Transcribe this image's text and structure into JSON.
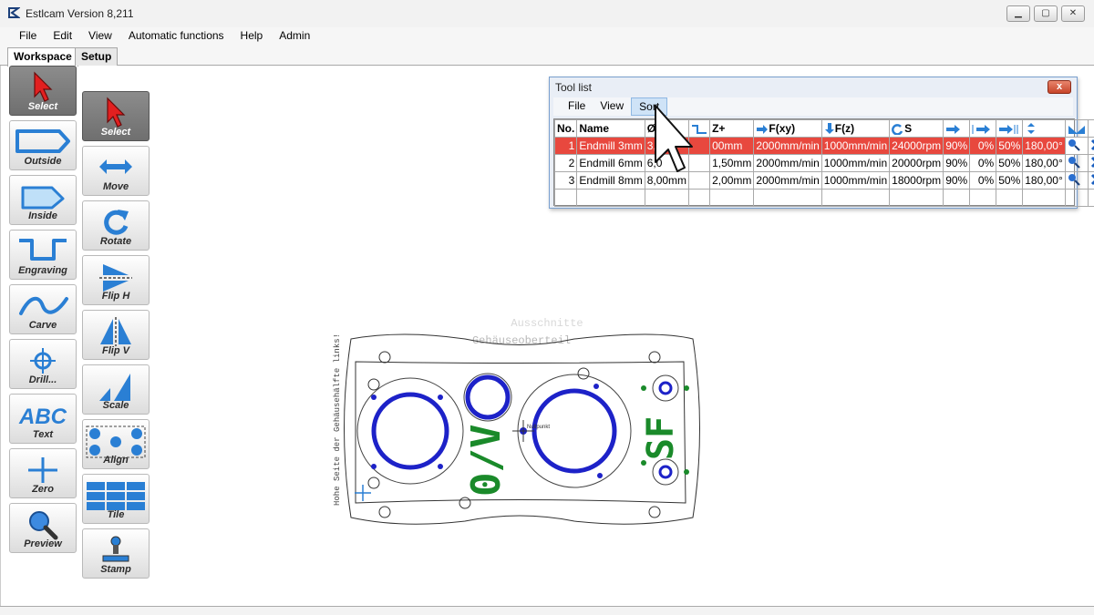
{
  "window": {
    "title": "Estlcam Version 8,211",
    "controls": [
      "minimize",
      "restore",
      "close"
    ]
  },
  "menu": [
    "File",
    "Edit",
    "View",
    "Automatic functions",
    "Help",
    "Admin"
  ],
  "tabs": [
    {
      "label": "Workspace",
      "active": true
    },
    {
      "label": "Setup",
      "active": false
    }
  ],
  "left_tools": [
    {
      "label": "Select",
      "icon": "arrow-pointer-icon",
      "selected": true
    },
    {
      "label": "Outside",
      "icon": "outside-contour-icon"
    },
    {
      "label": "Inside",
      "icon": "inside-contour-icon"
    },
    {
      "label": "Engraving",
      "icon": "engraving-icon"
    },
    {
      "label": "Carve",
      "icon": "carve-icon"
    },
    {
      "label": "Drill...",
      "icon": "drill-crosshair-icon"
    },
    {
      "label": "Text",
      "icon": "abc-text-icon"
    },
    {
      "label": "Zero",
      "icon": "zero-cross-icon"
    },
    {
      "label": "Preview",
      "icon": "magnifier-icon"
    }
  ],
  "right_tools": [
    {
      "label": "Select",
      "icon": "arrow-pointer-icon",
      "selected": true
    },
    {
      "label": "Move",
      "icon": "move-arrows-icon"
    },
    {
      "label": "Rotate",
      "icon": "rotate-icon"
    },
    {
      "label": "Flip H",
      "icon": "flip-horizontal-icon"
    },
    {
      "label": "Flip V",
      "icon": "flip-vertical-icon"
    },
    {
      "label": "Scale",
      "icon": "scale-icon"
    },
    {
      "label": "Align",
      "icon": "align-icon"
    },
    {
      "label": "Tile",
      "icon": "tile-icon"
    },
    {
      "label": "Stamp",
      "icon": "stamp-icon"
    }
  ],
  "tool_list": {
    "title": "Tool list",
    "close": "x",
    "menu": [
      "File",
      "View",
      "Sort"
    ],
    "hot_menu": "Sort",
    "headers": [
      "No.",
      "Name",
      "Ø",
      "",
      "Z+",
      "F(xy)",
      "F(z)",
      "S",
      "",
      "",
      "",
      "",
      "",
      ""
    ],
    "rows": [
      {
        "no": "1",
        "name": "Endmill 3mm",
        "dia": "3,0",
        "z": "00mm",
        "fxy": "2000mm/min",
        "fz": "1000mm/min",
        "s": "24000rpm",
        "p1": "90%",
        "p2": "0%",
        "p3": "50%",
        "angle": "180,00°",
        "selected": true
      },
      {
        "no": "2",
        "name": "Endmill 6mm",
        "dia": "6,0",
        "z": "1,50mm",
        "fxy": "2000mm/min",
        "fz": "1000mm/min",
        "s": "20000rpm",
        "p1": "90%",
        "p2": "0%",
        "p3": "50%",
        "angle": "180,00°",
        "selected": false
      },
      {
        "no": "3",
        "name": "Endmill 8mm",
        "dia": "8,00mm",
        "z": "2,00mm",
        "fxy": "2000mm/min",
        "fz": "1000mm/min",
        "s": "18000rpm",
        "p1": "90%",
        "p2": "0%",
        "p3": "50%",
        "angle": "180,00°",
        "selected": false
      }
    ]
  },
  "drawing": {
    "top_text_1": "Ausschnitte",
    "top_text_2": "Gehäuseoberteil",
    "side_text": "Hohe Seite der Gehäusehälfte links!",
    "center_label": "Nullpunkt",
    "engrave_1": "0/V",
    "engrave_2": "SF"
  },
  "colors": {
    "selected_row": "#e8483e",
    "cut_blue": "#1d22c8",
    "engrave_green": "#1a8a2a",
    "tool_blue": "#2a7fd4"
  }
}
